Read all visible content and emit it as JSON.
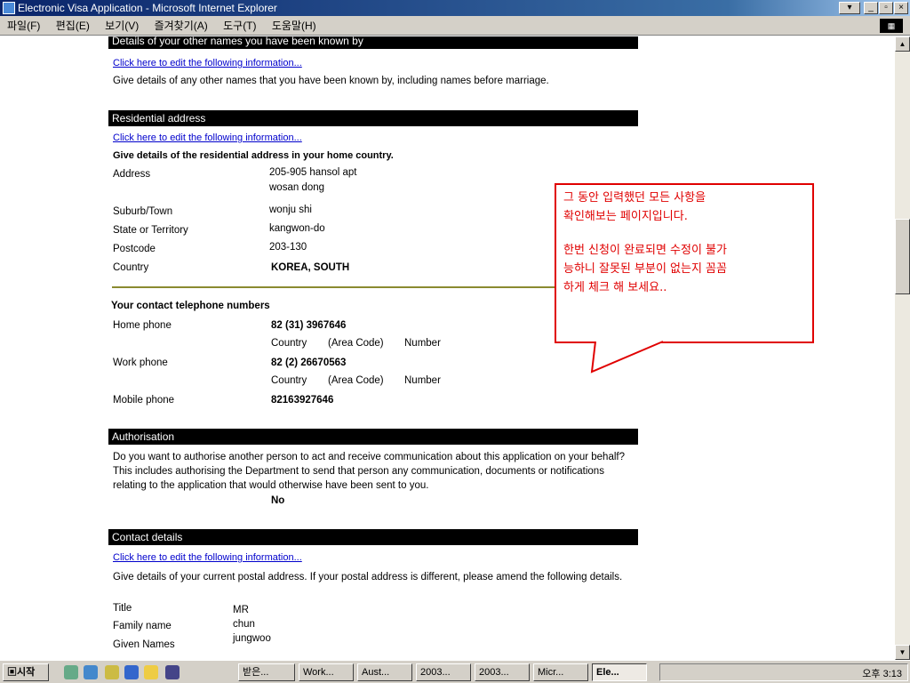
{
  "window": {
    "title": "Electronic Visa Application - Microsoft Internet Explorer"
  },
  "menu": [
    "파일(F)",
    "편집(E)",
    "보기(V)",
    "즐겨찾기(A)",
    "도구(T)",
    "도움말(H)"
  ],
  "sections": {
    "other_names": {
      "header": "Details of your other names you have been known by",
      "link": "Click here to edit the following information...",
      "text": "Give details of any other names that you have been known by, including names before marriage."
    },
    "residential": {
      "header": "Residential address",
      "link": "Click here to edit the following information...",
      "intro": "Give details of the residential address in your home country.",
      "address_label": "Address",
      "address_line1": "205-905 hansol apt",
      "address_line2": "wosan dong",
      "suburb_label": "Suburb/Town",
      "suburb": "wonju shi",
      "state_label": "State or Territory",
      "state": "kangwon-do",
      "postcode_label": "Postcode",
      "postcode": "203-130",
      "country_label": "Country",
      "country": "KOREA, SOUTH"
    },
    "phones": {
      "title": "Your contact telephone numbers",
      "home_label": "Home phone",
      "home": "82 (31) 3967646",
      "work_label": "Work phone",
      "work": "82 (2) 26670563",
      "mobile_label": "Mobile phone",
      "mobile": "82163927646",
      "col_country": "Country",
      "col_area": "(Area Code)",
      "col_number": "Number"
    },
    "authorisation": {
      "header": "Authorisation",
      "text": "Do you want to authorise another person to act and receive communication about this application on your behalf? This includes authorising the Department to send that person any communication, documents or notifications relating to the application that would otherwise have been sent to you.",
      "answer": "No"
    },
    "contact": {
      "header": "Contact details",
      "link": "Click here to edit the following information...",
      "text": "Give details of your current postal address. If your postal address is different, please amend the following details.",
      "title_label": "Title",
      "title": "MR",
      "family_label": "Family name",
      "family": "chun",
      "given_label": "Given Names",
      "given": "jungwoo"
    }
  },
  "callout": {
    "line1": "그 동안 입력했던 모든 사항을",
    "line2": "확인해보는 페이지입니다.",
    "line3": "한번 신청이 완료되면 수정이 불가",
    "line4": "능하니 잘못된 부분이 없는지 꼼꼼",
    "line5": "하게 체크 해 보세요.."
  },
  "taskbar": {
    "start": "시작",
    "tasks": [
      "받은...",
      "Work...",
      "Aust...",
      "2003...",
      "2003...",
      "Micr...",
      "Ele..."
    ],
    "clock": "오후 3:13"
  }
}
